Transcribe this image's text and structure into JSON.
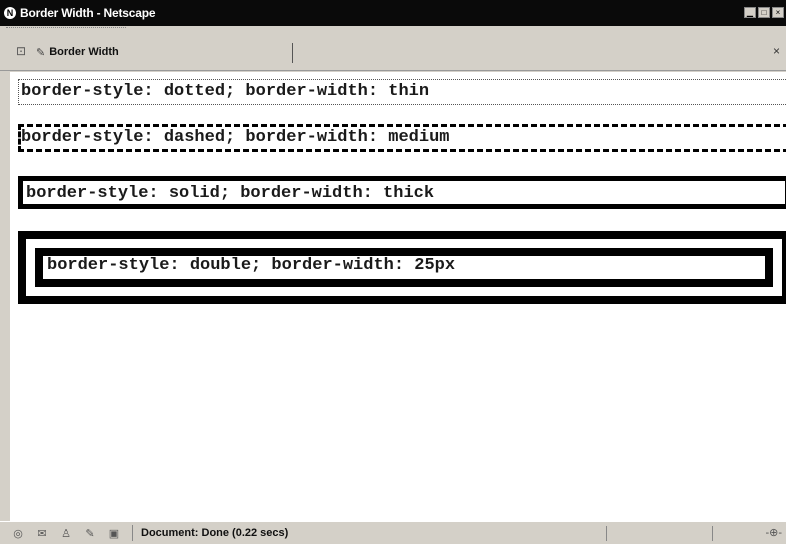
{
  "window": {
    "title": "Border Width - Netscape",
    "controls": {
      "minimize": "▁",
      "maximize": "□",
      "close": "×"
    }
  },
  "tabbar": {
    "tab_label": "Border Width",
    "close_glyph": "×"
  },
  "content": {
    "demos": [
      {
        "text": "border-style: dotted; border-width: thin"
      },
      {
        "text": "border-style: dashed; border-width: medium"
      },
      {
        "text": "border-style: solid; border-width: thick"
      },
      {
        "text": "border-style: double; border-width: 25px"
      }
    ]
  },
  "statusbar": {
    "text": "Document: Done (0.22 secs)",
    "icons": [
      "globe-icon",
      "mail-icon",
      "user-icon",
      "composer-icon",
      "addressbook-icon"
    ]
  },
  "colors": {
    "titlebar_bg": "#0a0a0a",
    "chrome_bg": "#d4d0c8",
    "content_bg": "#ffffff",
    "border_color": "#000000"
  }
}
